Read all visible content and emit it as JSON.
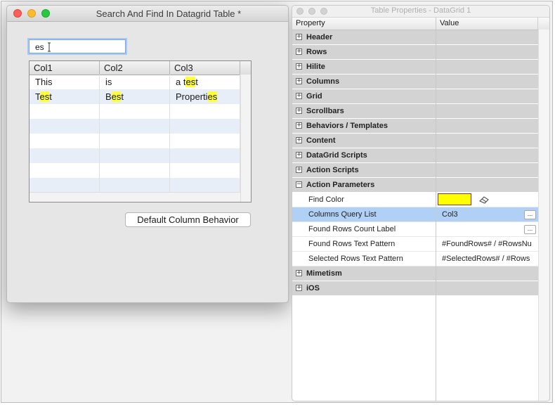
{
  "window1": {
    "title": "Search And Find In Datagrid Table *",
    "search_value": "es",
    "grid": {
      "columns": [
        "Col1",
        "Col2",
        "Col3"
      ],
      "rows": [
        [
          "This",
          "is",
          "a test"
        ],
        [
          "Test",
          "Best",
          "Properties"
        ]
      ]
    },
    "default_button_label": "Default Column Behavior",
    "highlight_color": "#ffff3a"
  },
  "window2": {
    "title": "Table Properties - DataGrid 1",
    "columns": [
      "Property",
      "Value"
    ],
    "groups_before": [
      "Header",
      "Rows",
      "Hilite",
      "Columns",
      "Grid",
      "Scrollbars",
      "Behaviors / Templates",
      "Content",
      "DataGrid Scripts",
      "Action Scripts"
    ],
    "expanded_group": "Action Parameters",
    "params": [
      {
        "label": "Find Color",
        "value": ""
      },
      {
        "label": "Columns Query List",
        "value": "Col3"
      },
      {
        "label": "Found Rows Count Label",
        "value": ""
      },
      {
        "label": "Found Rows Text Pattern",
        "value": "#FoundRows# / #RowsNu"
      },
      {
        "label": "Selected Rows Text Pattern",
        "value": "#SelectedRows# / #Rows"
      }
    ],
    "groups_after": [
      "Mimetism",
      "iOS"
    ],
    "expand_glyph": "+",
    "collapse_glyph": "−",
    "ellipsis": "...",
    "find_color": "#ffff00",
    "selection_color": "#b0d1f5"
  }
}
